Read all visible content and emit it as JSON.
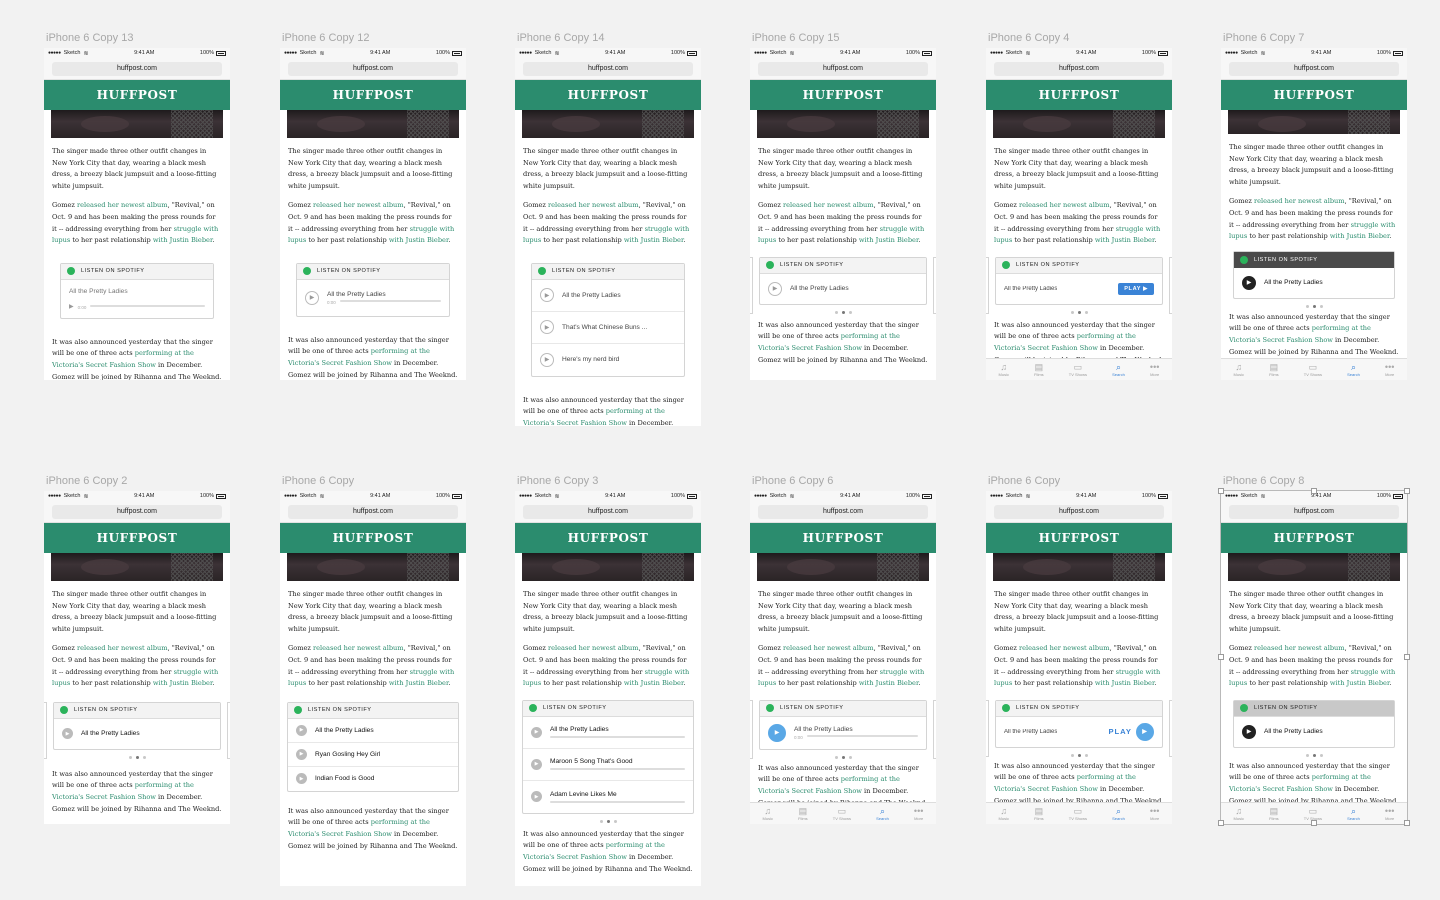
{
  "artboards": [
    {
      "label": "iPhone 6 Copy 13"
    },
    {
      "label": "iPhone 6 Copy 12"
    },
    {
      "label": "iPhone 6 Copy 14"
    },
    {
      "label": "iPhone 6 Copy 15"
    },
    {
      "label": "iPhone 6 Copy 4"
    },
    {
      "label": "iPhone 6 Copy 7"
    },
    {
      "label": "iPhone 6 Copy 2"
    },
    {
      "label": "iPhone 6 Copy"
    },
    {
      "label": "iPhone 6 Copy 3"
    },
    {
      "label": "iPhone 6 Copy 6"
    },
    {
      "label": "iPhone 6 Copy"
    },
    {
      "label": "iPhone 6 Copy 8"
    }
  ],
  "statusbar": {
    "carrier": "Sketch",
    "time": "9:41 AM",
    "battery": "100%"
  },
  "browser": {
    "url": "huffpost.com"
  },
  "brand": {
    "name": "HUFFPOST",
    "color": "#2b8c6e"
  },
  "article": {
    "p1": "The singer made three other outfit changes in New York City that day, wearing a black mesh dress, a breezy black jumpsuit and a loose-fitting white jumpsuit.",
    "p2_a": "Gomez ",
    "p2_link1": "released her newest album",
    "p2_b": ", \"Revival,\" on Oct. 9 and has been making the press rounds for it -- addressing everything from her ",
    "p2_link2": "struggle with lupus",
    "p2_c": " to her past relationship ",
    "p2_link3": "with Justin Bieber",
    "p2_d": ".",
    "p3_a": "It was also announced yesterday that the singer will be one of three acts ",
    "p3_link1": "performing at the Victoria's Secret Fashion Show",
    "p3_b": " in December. Gomez will be joined by Rihanna and The Weeknd."
  },
  "widget": {
    "header": "LISTEN ON SPOTIFY",
    "play_label": "PLAY",
    "time": "0:00",
    "track_main": "All the Pretty Ladies"
  },
  "tracks_a": [
    "All the Pretty Ladies",
    "That's What Chinese Buns ...",
    "Here's my nerd bird"
  ],
  "tracks_b": [
    "All the Pretty Ladies",
    "Ryan Gosling Hey Girl",
    "Indian Food is Good"
  ],
  "tracks_c": [
    "All the Pretty Ladies",
    "Maroon 5 Song That's Good",
    "Adam Levine Likes Me"
  ],
  "tabs": [
    "Music",
    "Films",
    "TV Shows",
    "Search",
    "More"
  ],
  "tab_icons": [
    "♫",
    "▤",
    "▭",
    "⌕",
    "•••"
  ]
}
